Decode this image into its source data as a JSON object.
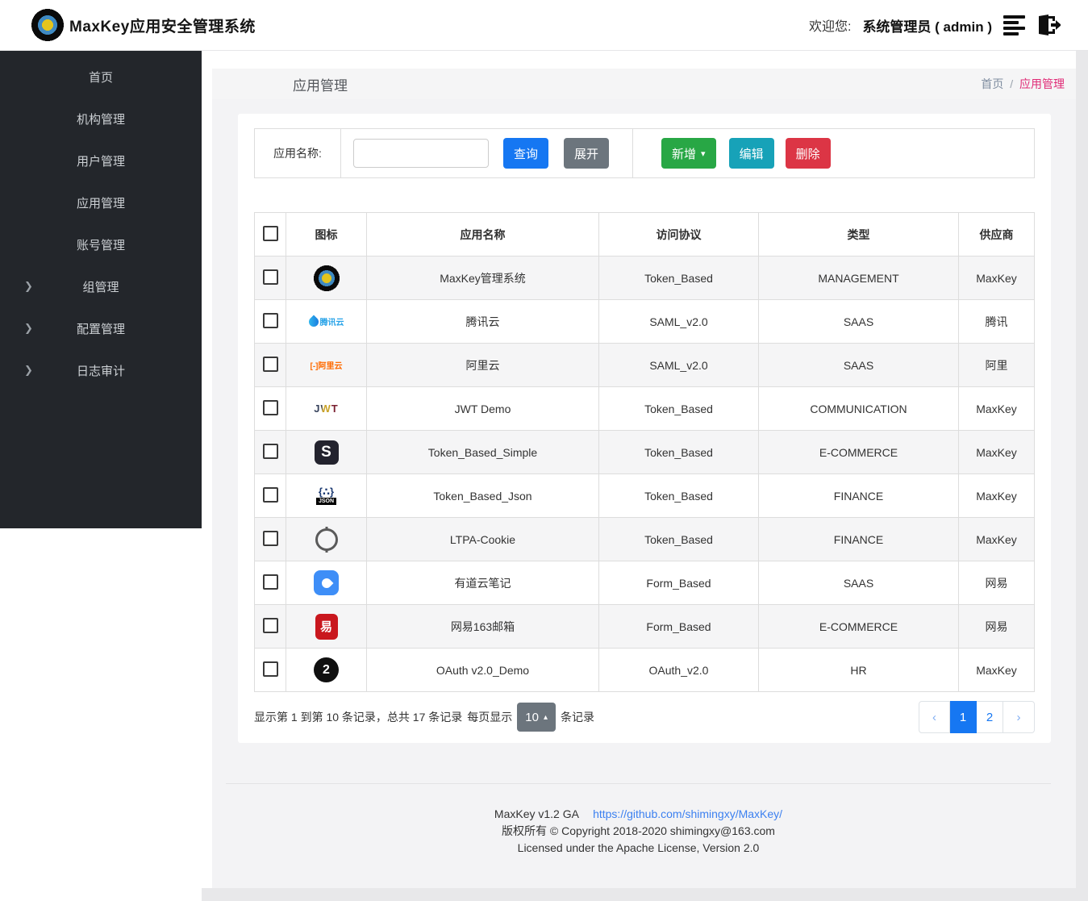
{
  "header": {
    "brand": "MaxKey应用安全管理系统",
    "welcome_prefix": "欢迎您:",
    "username": "系统管理员 ( admin )",
    "icons": {
      "maxkey-logo-icon": "black ring with blue ring and yellow core",
      "menu-icon": "hamburger bars",
      "logout-icon": "door with right arrow"
    }
  },
  "sidebar": {
    "items": [
      {
        "label": "首页",
        "has_children": false
      },
      {
        "label": "机构管理",
        "has_children": false
      },
      {
        "label": "用户管理",
        "has_children": false
      },
      {
        "label": "应用管理",
        "has_children": false
      },
      {
        "label": "账号管理",
        "has_children": false
      },
      {
        "label": "组管理",
        "has_children": true
      },
      {
        "label": "配置管理",
        "has_children": true
      },
      {
        "label": "日志审计",
        "has_children": true
      }
    ],
    "chevron": "❯"
  },
  "page": {
    "title": "应用管理",
    "breadcrumb": {
      "home": "首页",
      "separator": "/",
      "current": "应用管理"
    }
  },
  "toolbar": {
    "search_label": "应用名称:",
    "search_value": "",
    "query_label": "查询",
    "expand_label": "展开",
    "add_label": "新增",
    "add_caret": "▾",
    "edit_label": "编辑",
    "delete_label": "删除"
  },
  "table": {
    "columns": [
      "图标",
      "应用名称",
      "访问协议",
      "类型",
      "供应商"
    ],
    "rows": [
      {
        "icon": "maxkey-logo-icon",
        "icon_text": "",
        "name": "MaxKey管理系统",
        "protocol": "Token_Based",
        "type": "MANAGEMENT",
        "vendor": "MaxKey"
      },
      {
        "icon": "tencent-cloud-icon",
        "icon_text": "腾讯云",
        "name": "腾讯云",
        "protocol": "SAML_v2.0",
        "type": "SAAS",
        "vendor": "腾讯"
      },
      {
        "icon": "aliyun-icon",
        "icon_text": "[-]阿里云",
        "name": "阿里云",
        "protocol": "SAML_v2.0",
        "type": "SAAS",
        "vendor": "阿里"
      },
      {
        "icon": "jwt-icon",
        "icon_text": "JWT",
        "name": "JWT Demo",
        "protocol": "Token_Based",
        "type": "COMMUNICATION",
        "vendor": "MaxKey"
      },
      {
        "icon": "simple-icon",
        "icon_text": "S",
        "name": "Token_Based_Simple",
        "protocol": "Token_Based",
        "type": "E-COMMERCE",
        "vendor": "MaxKey"
      },
      {
        "icon": "json-icon",
        "icon_text": "{∴}",
        "icon_sub": "JSON",
        "name": "Token_Based_Json",
        "protocol": "Token_Based",
        "type": "FINANCE",
        "vendor": "MaxKey"
      },
      {
        "icon": "ltpa-icon",
        "icon_text": "",
        "name": "LTPA-Cookie",
        "protocol": "Token_Based",
        "type": "FINANCE",
        "vendor": "MaxKey"
      },
      {
        "icon": "youdao-icon",
        "icon_text": "",
        "name": "有道云笔记",
        "protocol": "Form_Based",
        "type": "SAAS",
        "vendor": "网易"
      },
      {
        "icon": "netease163-icon",
        "icon_text": "易",
        "name": "网易163邮箱",
        "protocol": "Form_Based",
        "type": "E-COMMERCE",
        "vendor": "网易"
      },
      {
        "icon": "oauth2-icon",
        "icon_text": "2",
        "name": "OAuth v2.0_Demo",
        "protocol": "OAuth_v2.0",
        "type": "HR",
        "vendor": "MaxKey"
      }
    ]
  },
  "pagination": {
    "summary": "显示第 1 到第 10 条记录，总共 17 条记录",
    "per_page_label": "每页显示",
    "page_size": "10",
    "size_caret": "▴",
    "unit_label": "条记录",
    "prev_label": "‹",
    "next_label": "›",
    "pages": [
      "1",
      "2"
    ],
    "active_page": "1"
  },
  "footer": {
    "version": "MaxKey  v1.2 GA",
    "link": "https://github.com/shimingxy/MaxKey/",
    "copyright": "版权所有 © Copyright 2018-2020 shimingxy@163.com",
    "license": "Licensed under the Apache License, Version 2.0"
  },
  "colors": {
    "primary_blue": "#1677f2",
    "secondary_gray": "#6c757d",
    "success_green": "#28a745",
    "info_teal": "#17a2b8",
    "danger_red": "#dc3545",
    "breadcrumb_pink": "#e02a76",
    "sidebar_bg": "#23262b",
    "content_bg": "#f3f3f5",
    "table_border": "#dddddd",
    "stripe_bg": "#f5f5f6",
    "link_blue": "#3c80f0"
  }
}
